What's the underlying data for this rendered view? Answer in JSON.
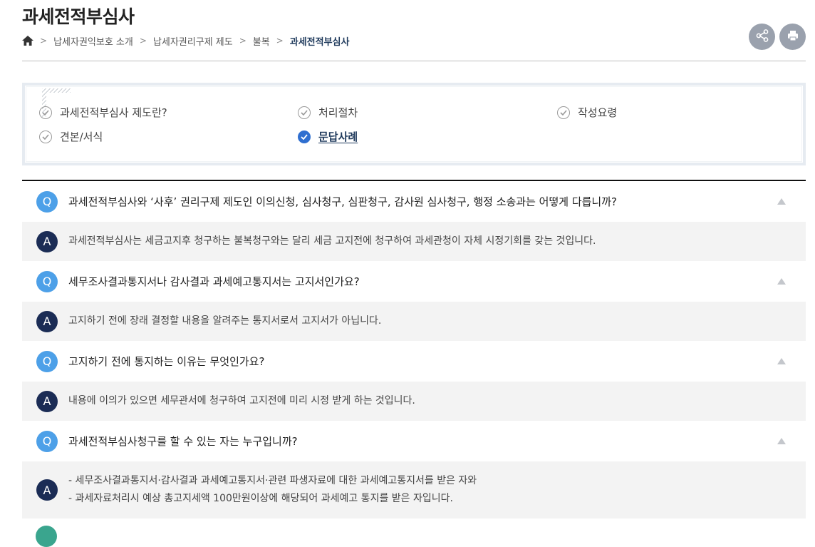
{
  "page_title": "과세전적부심사",
  "breadcrumb": [
    "납세자권익보호 소개",
    "납세자권리구제 제도",
    "불복",
    "과세전적부심사"
  ],
  "actions": {
    "share_icon": "share-icon",
    "print_icon": "print-icon",
    "color": "#9aa1ad"
  },
  "sub_nav": {
    "items": [
      "과세전적부심사 제도란?",
      "처리절차",
      "작성요령",
      "견본/서식",
      "문답사례"
    ],
    "active_index": 4,
    "active_color": "#2f6fd0"
  },
  "faq": {
    "q_badge": "Q",
    "a_badge": "A",
    "items": [
      {
        "question": "과세전적부심사와 ‘사후’ 권리구제 제도인 이의신청, 심사청구, 심판청구, 감사원 심사청구, 행정 소송과는 어떻게 다릅니까?",
        "answer": [
          "과세전적부심사는 세금고지후 청구하는 불복청구와는 달리 세금 고지전에 청구하여 과세관청이 자체 시정기회를 갖는 것입니다."
        ]
      },
      {
        "question": "세무조사결과통지서나 감사결과 과세예고통지서는 고지서인가요?",
        "answer": [
          "고지하기 전에 장래 결정할 내용을 알려주는 통지서로서 고지서가 아닙니다."
        ]
      },
      {
        "question": "고지하기 전에 통지하는 이유는 무엇인가요?",
        "answer": [
          "내용에 이의가 있으면 세무관서에 청구하여 고지전에 미리 시정 받게 하는 것입니다."
        ]
      },
      {
        "question": "과세전적부심사청구를 할 수 있는 자는 누구입니까?",
        "answer": [
          "- 세무조사결과통지서·감사결과 과세예고통지서·관련 파생자료에 대한 과세예고통지서를 받은 자와",
          "- 과세자료처리시 예상 총고지세액 100만원이상에 해당되어 과세예고 통지를 받은 자입니다."
        ]
      }
    ]
  }
}
